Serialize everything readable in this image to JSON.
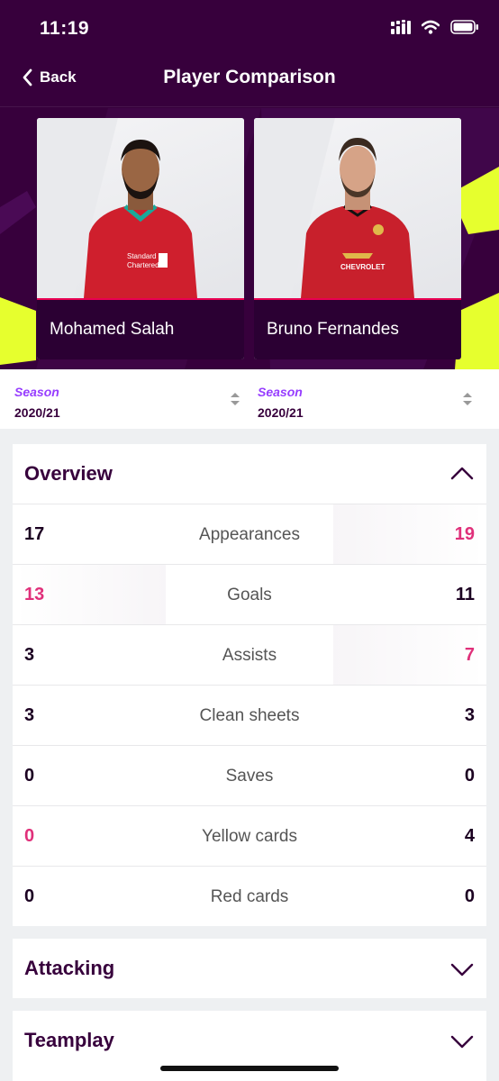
{
  "status_bar": {
    "time": "11:19"
  },
  "nav": {
    "back_label": "Back",
    "title": "Player Comparison"
  },
  "players": [
    {
      "name": "Mohamed Salah",
      "kit_color": "#d0202e",
      "sponsor": "Standard Chartered"
    },
    {
      "name": "Bruno Fernandes",
      "kit_color": "#d0202e",
      "sponsor": "CHEVROLET"
    }
  ],
  "season": [
    {
      "label": "Season",
      "value": "2020/21"
    },
    {
      "label": "Season",
      "value": "2020/21"
    }
  ],
  "overview": {
    "title": "Overview",
    "rows": [
      {
        "label": "Appearances",
        "left": "17",
        "right": "19",
        "winner": "right"
      },
      {
        "label": "Goals",
        "left": "13",
        "right": "11",
        "winner": "left"
      },
      {
        "label": "Assists",
        "left": "3",
        "right": "7",
        "winner": "right"
      },
      {
        "label": "Clean sheets",
        "left": "3",
        "right": "3",
        "winner": "none"
      },
      {
        "label": "Saves",
        "left": "0",
        "right": "0",
        "winner": "none"
      },
      {
        "label": "Yellow cards",
        "left": "0",
        "right": "4",
        "winner": "left"
      },
      {
        "label": "Red cards",
        "left": "0",
        "right": "0",
        "winner": "none"
      }
    ]
  },
  "sections": [
    {
      "title": "Attacking",
      "expanded": false
    },
    {
      "title": "Teamplay",
      "expanded": false
    }
  ],
  "colors": {
    "brand_purple": "#37003c",
    "accent_pink": "#e0307a",
    "accent_lime": "#e6ff2e",
    "season_label": "#963cff"
  }
}
